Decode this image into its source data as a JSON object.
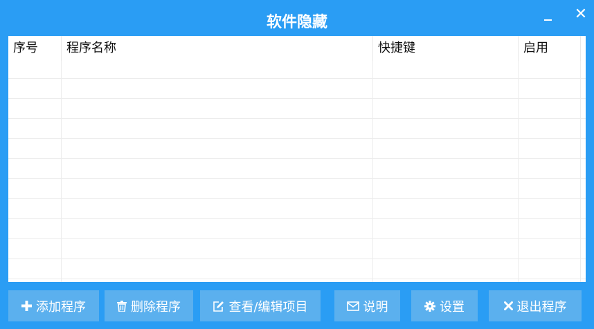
{
  "window": {
    "title": "软件隐藏",
    "minimize_icon": "minimize-icon",
    "close_icon": "close-icon",
    "accent_color": "#2a9df4",
    "button_color": "#5bb0ee"
  },
  "table": {
    "columns": [
      "序号",
      "程序名称",
      "快捷键",
      "启用"
    ],
    "rows": [
      [],
      [],
      [],
      [],
      [],
      [],
      [],
      [],
      [],
      [],
      [],
      []
    ]
  },
  "toolbar": {
    "buttons": [
      {
        "label": "添加程序",
        "icon": "plus-icon"
      },
      {
        "label": "删除程序",
        "icon": "trash-icon"
      },
      {
        "label": "查看/编辑项目",
        "icon": "edit-icon"
      },
      {
        "label": "说明",
        "icon": "envelope-icon"
      },
      {
        "label": "设置",
        "icon": "gear-icon"
      },
      {
        "label": "退出程序",
        "icon": "x-icon"
      }
    ]
  }
}
